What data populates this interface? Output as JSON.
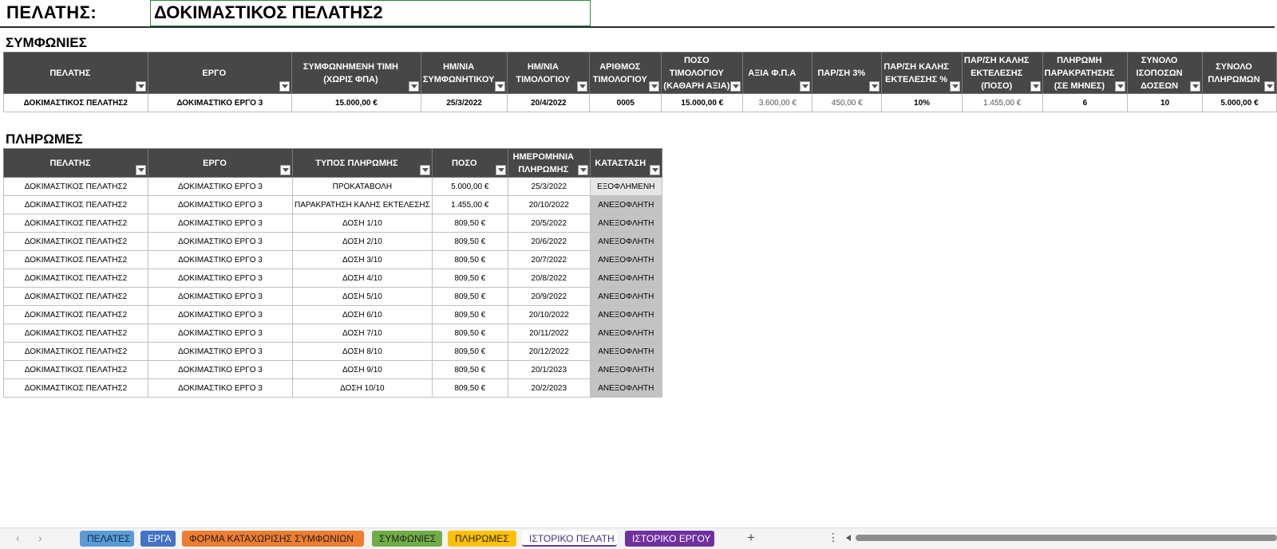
{
  "client": {
    "label": "ΠΕΛΑΤΗΣ:",
    "value": "ΔΟΚΙΜΑΣΤΙΚΟΣ ΠΕΛΑΤΗΣ2"
  },
  "agreements": {
    "title": "ΣΥΜΦΩΝΙΕΣ",
    "headers": [
      [
        "ΠΕΛΑΤΗΣ"
      ],
      [
        "ΕΡΓΟ"
      ],
      [
        "ΣΥΜΦΩΝΗΜΕΝΗ ΤΙΜΗ",
        "(ΧΩΡΙΣ ΦΠΑ)"
      ],
      [
        "ΗΜ/ΝΙΑ",
        "ΣΥΜΦΩΝΗΤΙΚΟΥ"
      ],
      [
        "ΗΜ/ΝΙΑ",
        "ΤΙΜΟΛΟΓΙΟΥ"
      ],
      [
        "ΑΡΙΘΜΟΣ",
        "ΤΙΜΟΛΟΓΙΟΥ"
      ],
      [
        "ΠΟΣΟ",
        "ΤΙΜΟΛΟΓΙΟΥ",
        "(ΚΑΘΑΡΗ ΑΞΙΑ)"
      ],
      [
        "ΑΞΙΑ Φ.Π.Α"
      ],
      [
        "ΠΑΡ/ΣΗ 3%"
      ],
      [
        "ΠΑΡ/ΣΗ ΚΑΛΗΣ",
        "ΕΚΤΕΛΕΣΗΣ %"
      ],
      [
        "ΠΑΡ/ΣΗ ΚΑΛΗΣ",
        "ΕΚΤΕΛΕΣΗΣ",
        "(ΠΟΣΟ)"
      ],
      [
        "ΠΛΗΡΩΜΗ",
        "ΠΑΡΑΚΡΑΤΗΣΗΣ",
        "(ΣΕ ΜΗΝΕΣ)"
      ],
      [
        "ΣΥΝΟΛΟ",
        "ΙΣΟΠΟΣΩΝ",
        "ΔΟΣΕΩΝ"
      ],
      [
        "ΣΥΝΟΛΟ",
        "ΠΛΗΡΩΜΩΝ"
      ]
    ],
    "rows": [
      [
        "ΔΟΚΙΜΑΣΤΙΚΟΣ ΠΕΛΑΤΗΣ2",
        "ΔΟΚΙΜΑΣΤΙΚΟ ΕΡΓΟ 3",
        "15.000,00 €",
        "25/3/2022",
        "20/4/2022",
        "0005",
        "15.000,00 €",
        "3.600,00 €",
        "450,00 €",
        "10%",
        "1.455,00 €",
        "6",
        "10",
        "5.000,00 €"
      ]
    ]
  },
  "payments": {
    "title": "ΠΛΗΡΩΜΕΣ",
    "headers": [
      [
        "ΠΕΛΑΤΗΣ"
      ],
      [
        "ΕΡΓΟ"
      ],
      [
        "ΤΥΠΟΣ ΠΛΗΡΩΜΗΣ"
      ],
      [
        "ΠΟΣΟ"
      ],
      [
        "ΗΜΕΡΟΜΗΝΙΑ",
        "ΠΛΗΡΩΜΗΣ"
      ],
      [
        "ΚΑΤΑΣΤΑΣΗ"
      ]
    ],
    "rows": [
      [
        "ΔΟΚΙΜΑΣΤΙΚΟΣ ΠΕΛΑΤΗΣ2",
        "ΔΟΚΙΜΑΣΤΙΚΟ ΕΡΓΟ 3",
        "ΠΡΟΚΑΤΑΒΟΛΗ",
        "5.000,00 €",
        "25/3/2022",
        "ΕΞΟΦΛΗΜΕΝΗ"
      ],
      [
        "ΔΟΚΙΜΑΣΤΙΚΟΣ ΠΕΛΑΤΗΣ2",
        "ΔΟΚΙΜΑΣΤΙΚΟ ΕΡΓΟ 3",
        "ΠΑΡΑΚΡΑΤΗΣΗ ΚΑΛΗΣ ΕΚΤΕΛΕΣΗΣ",
        "1.455,00 €",
        "20/10/2022",
        "ΑΝΕΞΟΦΛΗΤΗ"
      ],
      [
        "ΔΟΚΙΜΑΣΤΙΚΟΣ ΠΕΛΑΤΗΣ2",
        "ΔΟΚΙΜΑΣΤΙΚΟ ΕΡΓΟ 3",
        "ΔΟΣΗ 1/10",
        "809,50 €",
        "20/5/2022",
        "ΑΝΕΞΟΦΛΗΤΗ"
      ],
      [
        "ΔΟΚΙΜΑΣΤΙΚΟΣ ΠΕΛΑΤΗΣ2",
        "ΔΟΚΙΜΑΣΤΙΚΟ ΕΡΓΟ 3",
        "ΔΟΣΗ 2/10",
        "809,50 €",
        "20/6/2022",
        "ΑΝΕΞΟΦΛΗΤΗ"
      ],
      [
        "ΔΟΚΙΜΑΣΤΙΚΟΣ ΠΕΛΑΤΗΣ2",
        "ΔΟΚΙΜΑΣΤΙΚΟ ΕΡΓΟ 3",
        "ΔΟΣΗ 3/10",
        "809,50 €",
        "20/7/2022",
        "ΑΝΕΞΟΦΛΗΤΗ"
      ],
      [
        "ΔΟΚΙΜΑΣΤΙΚΟΣ ΠΕΛΑΤΗΣ2",
        "ΔΟΚΙΜΑΣΤΙΚΟ ΕΡΓΟ 3",
        "ΔΟΣΗ 4/10",
        "809,50 €",
        "20/8/2022",
        "ΑΝΕΞΟΦΛΗΤΗ"
      ],
      [
        "ΔΟΚΙΜΑΣΤΙΚΟΣ ΠΕΛΑΤΗΣ2",
        "ΔΟΚΙΜΑΣΤΙΚΟ ΕΡΓΟ 3",
        "ΔΟΣΗ 5/10",
        "809,50 €",
        "20/9/2022",
        "ΑΝΕΞΟΦΛΗΤΗ"
      ],
      [
        "ΔΟΚΙΜΑΣΤΙΚΟΣ ΠΕΛΑΤΗΣ2",
        "ΔΟΚΙΜΑΣΤΙΚΟ ΕΡΓΟ 3",
        "ΔΟΣΗ 6/10",
        "809,50 €",
        "20/10/2022",
        "ΑΝΕΞΟΦΛΗΤΗ"
      ],
      [
        "ΔΟΚΙΜΑΣΤΙΚΟΣ ΠΕΛΑΤΗΣ2",
        "ΔΟΚΙΜΑΣΤΙΚΟ ΕΡΓΟ 3",
        "ΔΟΣΗ 7/10",
        "809,50 €",
        "20/11/2022",
        "ΑΝΕΞΟΦΛΗΤΗ"
      ],
      [
        "ΔΟΚΙΜΑΣΤΙΚΟΣ ΠΕΛΑΤΗΣ2",
        "ΔΟΚΙΜΑΣΤΙΚΟ ΕΡΓΟ 3",
        "ΔΟΣΗ 8/10",
        "809,50 €",
        "20/12/2022",
        "ΑΝΕΞΟΦΛΗΤΗ"
      ],
      [
        "ΔΟΚΙΜΑΣΤΙΚΟΣ ΠΕΛΑΤΗΣ2",
        "ΔΟΚΙΜΑΣΤΙΚΟ ΕΡΓΟ 3",
        "ΔΟΣΗ 9/10",
        "809,50 €",
        "20/1/2023",
        "ΑΝΕΞΟΦΛΗΤΗ"
      ],
      [
        "ΔΟΚΙΜΑΣΤΙΚΟΣ ΠΕΛΑΤΗΣ2",
        "ΔΟΚΙΜΑΣΤΙΚΟ ΕΡΓΟ 3",
        "ΔΟΣΗ 10/10",
        "809,50 €",
        "20/2/2023",
        "ΑΝΕΞΟΦΛΗΤΗ"
      ]
    ]
  },
  "sheet_tabs": [
    {
      "label": "ΠΕΛΑΤΕΣ",
      "color": "#5b9bd5",
      "active": false
    },
    {
      "label": "ΕΡΓΑ",
      "color": "#4472c4",
      "active": false
    },
    {
      "label": "ΦΟΡΜΑ ΚΑΤΑΧΩΡΙΣΗΣ ΣΥΜΦΩΝΙΩΝ",
      "color": "#ed7d31",
      "active": false
    },
    {
      "label": "ΣΥΜΦΩΝΙΕΣ",
      "color": "#70ad47",
      "active": false
    },
    {
      "label": "ΠΛΗΡΩΜΕΣ",
      "color": "#ffc000",
      "active": false
    },
    {
      "label": "ΙΣΤΟΡΙΚΟ ΠΕΛΑΤΗ",
      "color": "#ffffff",
      "active": true
    },
    {
      "label": "ΙΣΤΟΡΙΚΟ ΕΡΓΟΥ",
      "color": "#7030a0",
      "active": false
    }
  ],
  "icons": {
    "prev": "chevron-left-icon",
    "next": "chevron-right-icon",
    "add": "plus-icon",
    "more": "more-options-icon",
    "filter": "filter-dropdown-icon"
  }
}
